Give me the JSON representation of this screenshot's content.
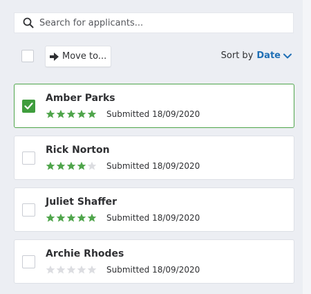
{
  "search": {
    "placeholder": "Search for applicants...",
    "value": "",
    "icon": "search-icon"
  },
  "toolbar": {
    "move_label": "Move to...",
    "move_icon": "arrow-right-icon",
    "sort_label": "Sort by",
    "sort_value": "Date",
    "sort_icon": "chevron-down-icon",
    "select_all_checked": false
  },
  "applicants": [
    {
      "name": "Amber Parks",
      "rating": 5,
      "submitted": "Submitted 18/09/2020",
      "selected": true
    },
    {
      "name": "Rick Norton",
      "rating": 4,
      "submitted": "Submitted 18/09/2020",
      "selected": false
    },
    {
      "name": "Juliet Shaffer",
      "rating": 5,
      "submitted": "Submitted 18/09/2020",
      "selected": false
    },
    {
      "name": "Archie Rhodes",
      "rating": 0,
      "submitted": "Submitted 18/09/2020",
      "selected": false
    }
  ],
  "max_rating": 5,
  "colors": {
    "star_filled": "#4fa54b",
    "star_empty": "#dcdde1",
    "accent_blue": "#1f6fb5",
    "selected_green": "#3f9d3d",
    "background": "#eceef3"
  }
}
